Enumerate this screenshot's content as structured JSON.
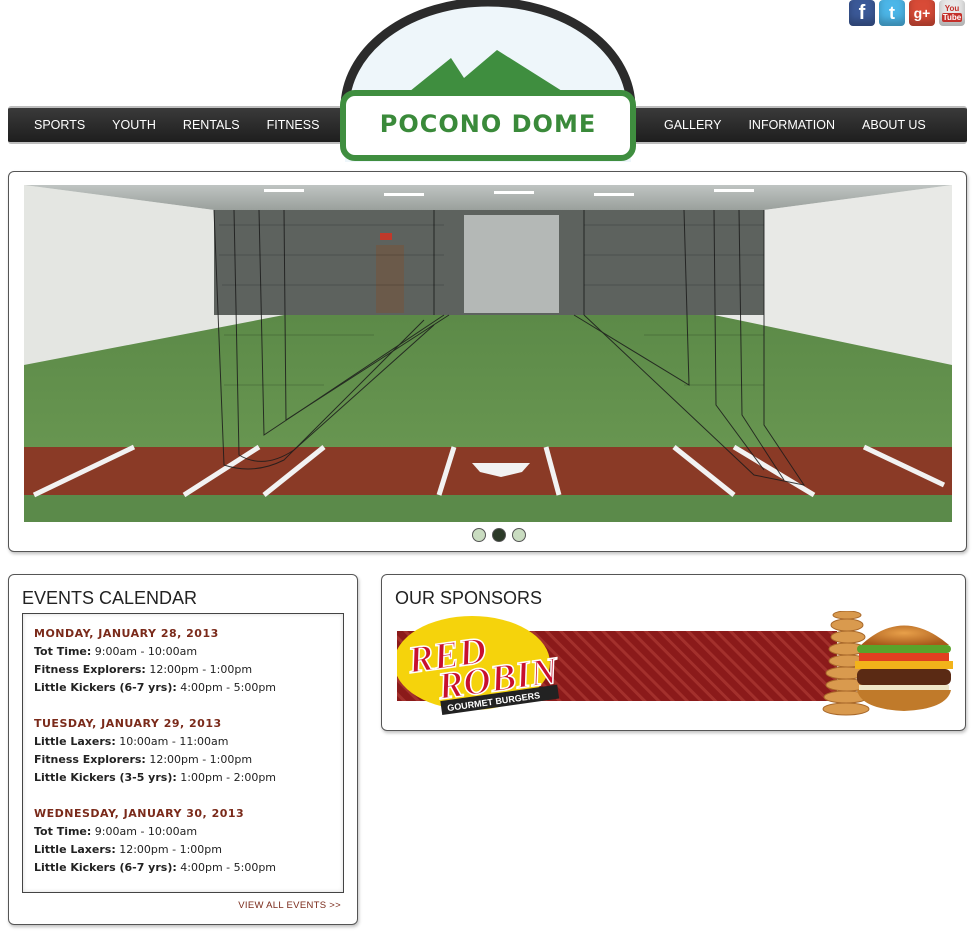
{
  "social": [
    {
      "name": "facebook",
      "glyph": "f"
    },
    {
      "name": "twitter",
      "glyph": "t"
    },
    {
      "name": "google-plus",
      "glyph": "g+"
    },
    {
      "name": "youtube",
      "glyph_top": "You",
      "glyph_bottom": "Tube"
    }
  ],
  "nav": {
    "left": [
      "SPORTS",
      "YOUTH",
      "RENTALS",
      "FITNESS"
    ],
    "right": [
      "GALLERY",
      "INFORMATION",
      "ABOUT US"
    ]
  },
  "logo": {
    "text": "POCONO DOME"
  },
  "slider": {
    "slide_count": 3,
    "active_index": 1
  },
  "events": {
    "title": "EVENTS CALENDAR",
    "days": [
      {
        "date": "MONDAY, JANUARY 28, 2013",
        "items": [
          {
            "name": "Tot Time:",
            "time": " 9:00am - 10:00am"
          },
          {
            "name": "Fitness Explorers:",
            "time": " 12:00pm - 1:00pm"
          },
          {
            "name": "Little Kickers (6-7 yrs):",
            "time": " 4:00pm - 5:00pm"
          }
        ]
      },
      {
        "date": "TUESDAY, JANUARY 29, 2013",
        "items": [
          {
            "name": "Little Laxers:",
            "time": " 10:00am - 11:00am"
          },
          {
            "name": "Fitness Explorers:",
            "time": " 12:00pm - 1:00pm"
          },
          {
            "name": "Little Kickers (3-5 yrs):",
            "time": " 1:00pm - 2:00pm"
          }
        ]
      },
      {
        "date": "WEDNESDAY, JANUARY 30, 2013",
        "items": [
          {
            "name": "Tot Time:",
            "time": " 9:00am - 10:00am"
          },
          {
            "name": "Little Laxers:",
            "time": " 12:00pm - 1:00pm"
          },
          {
            "name": "Little Kickers (6-7 yrs):",
            "time": " 4:00pm - 5:00pm"
          }
        ]
      }
    ],
    "view_all": "VIEW ALL EVENTS >>"
  },
  "sponsors": {
    "title": "OUR SPONSORS",
    "banner": {
      "line1": "RED",
      "line2": "ROBIN",
      "tagline": "GOURMET BURGERS"
    }
  },
  "colors": {
    "accent_green": "#3a8a3a",
    "nav_dark": "#2a2a2a",
    "date_red": "#7a2a1a",
    "banner_red": "#8b1a1a"
  }
}
